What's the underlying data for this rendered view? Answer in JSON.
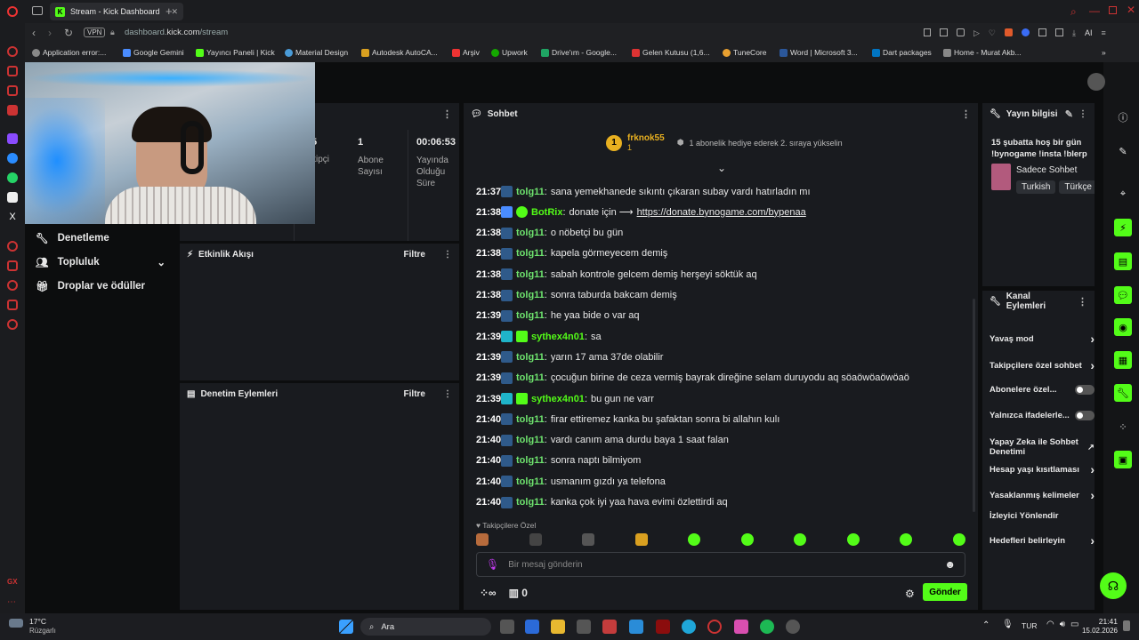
{
  "browser": {
    "tab_title": "Stream - Kick Dashboard",
    "url_prefix": "dashboard.",
    "url_domain": "kick.com",
    "url_path": "/stream",
    "vpn": "VPN",
    "ai": "AI",
    "bookmarks": [
      "Application error:...",
      "Google Gemini",
      "Yayıncı Paneli | Kick",
      "Material Design",
      "Autodesk AutoCA...",
      "Arşiv",
      "Upwork",
      "Drive'ım - Google...",
      "Gelen Kutusu (1,6...",
      "TuneCore",
      "Word | Microsoft 3...",
      "Dart packages",
      "Home - Murat Akb..."
    ]
  },
  "nav": {
    "items": [
      {
        "label": "Denetleme"
      },
      {
        "label": "Topluluk"
      },
      {
        "label": "Droplar ve ödüller"
      }
    ]
  },
  "stats": {
    "left_partial": "5",
    "left_label": "kipçi",
    "subs": "1",
    "subs_label_1": "Abone",
    "subs_label_2": "Sayısı",
    "time": "00:06:53",
    "time_l1": "Yayında",
    "time_l2": "Olduğu",
    "time_l3": "Süre"
  },
  "activity": {
    "title": "Etkinlik Akışı",
    "filter": "Filtre"
  },
  "modactions": {
    "title": "Denetim Eylemleri",
    "filter": "Filtre"
  },
  "chat": {
    "title": "Sohbet",
    "pinned_user": "frknok55",
    "pinned_count": "1",
    "pinned_text": "1 abonelik hediye ederek 2. sıraya yükselin",
    "messages": [
      {
        "time": "21:37",
        "user": "tolg11",
        "text": "sana yemekhanede sıkıntı çıkaran subay vardı hatırladın mı",
        "color": "#6ee36e",
        "badge": "b"
      },
      {
        "time": "21:38",
        "user": "BotRix",
        "text": "donate için ⟶ ",
        "link": "https://donate.bynogame.com/bypenaa",
        "color": "#53fc18",
        "badge": "bot"
      },
      {
        "time": "21:38",
        "user": "tolg11",
        "text": "o nöbetçi bu gün",
        "color": "#6ee36e",
        "badge": "b"
      },
      {
        "time": "21:38",
        "user": "tolg11",
        "text": "kapela görmeyecem demiş",
        "color": "#6ee36e",
        "badge": "b"
      },
      {
        "time": "21:38",
        "user": "tolg11",
        "text": "sabah kontrole gelcem demiş herşeyi söktük aq",
        "color": "#6ee36e",
        "badge": "b"
      },
      {
        "time": "21:38",
        "user": "tolg11",
        "text": "sonra taburda bakcam demiş",
        "color": "#6ee36e",
        "badge": "b"
      },
      {
        "time": "21:39",
        "user": "tolg11",
        "text": "he yaa bide o var aq",
        "color": "#6ee36e",
        "badge": "b"
      },
      {
        "time": "21:39",
        "user": "sythex4n01",
        "text": "sa",
        "color": "#53fc18",
        "badge": "s"
      },
      {
        "time": "21:39",
        "user": "tolg11",
        "text": "yarın 17 ama 37de olabilir",
        "color": "#6ee36e",
        "badge": "b"
      },
      {
        "time": "21:39",
        "user": "tolg11",
        "text": "çocuğun birine de ceza vermiş bayrak direğine selam duruyodu aq söaöwöaöwöaö",
        "color": "#6ee36e",
        "badge": "b"
      },
      {
        "time": "21:39",
        "user": "sythex4n01",
        "text": "bu gun ne varr",
        "color": "#53fc18",
        "badge": "s"
      },
      {
        "time": "21:40",
        "user": "tolg11",
        "text": "firar ettiremez kanka bu şafaktan sonra bi allahın kulı",
        "color": "#6ee36e",
        "badge": "b"
      },
      {
        "time": "21:40",
        "user": "tolg11",
        "text": "vardı canım ama durdu baya 1 saat falan",
        "color": "#6ee36e",
        "badge": "b"
      },
      {
        "time": "21:40",
        "user": "tolg11",
        "text": "sonra naptı bilmiyom",
        "color": "#6ee36e",
        "badge": "b"
      },
      {
        "time": "21:40",
        "user": "tolg11",
        "text": "usmanım gızdı ya telefona",
        "color": "#6ee36e",
        "badge": "b"
      },
      {
        "time": "21:40",
        "user": "tolg11",
        "text": "kanka çok iyi yaa hava evimi özlettirdi aq",
        "color": "#6ee36e",
        "badge": "b"
      }
    ],
    "follower_label": "Takipçilere Özel",
    "input_placeholder": "Bir mesaj gönderin",
    "points": "0",
    "send": "Gönder"
  },
  "stream_info": {
    "title": "Yayın bilgisi",
    "stream_title": "15 şubatta hoş bir gün !bynogame !insta !blerp",
    "category": "Sadece Sohbet",
    "tags": [
      "Turkish",
      "Türkçe"
    ]
  },
  "channel_actions": {
    "title": "Kanal Eylemleri",
    "items": [
      {
        "label": "Yavaş mod",
        "kind": "chevron"
      },
      {
        "label": "Takipçilere özel sohbet",
        "kind": "chevron"
      },
      {
        "label": "Abonelere özel...",
        "kind": "toggle"
      },
      {
        "label": "Yalnızca ifadelerle...",
        "kind": "toggle"
      },
      {
        "label": "Yapay Zeka ile Sohbet Denetimi",
        "kind": "external"
      },
      {
        "label": "Hesap yaşı kısıtlaması",
        "kind": "chevron"
      },
      {
        "label": "Yasaklanmış kelimeler",
        "kind": "chevron"
      },
      {
        "label": "İzleyici Yönlendir",
        "kind": "none"
      },
      {
        "label": "Hedefleri belirleyin",
        "kind": "chevron"
      }
    ]
  },
  "taskbar": {
    "temp": "17°C",
    "weather": "Rüzgarlı",
    "search": "Ara",
    "lang": "TUR",
    "time": "21:41",
    "date": "15.02.2026"
  }
}
